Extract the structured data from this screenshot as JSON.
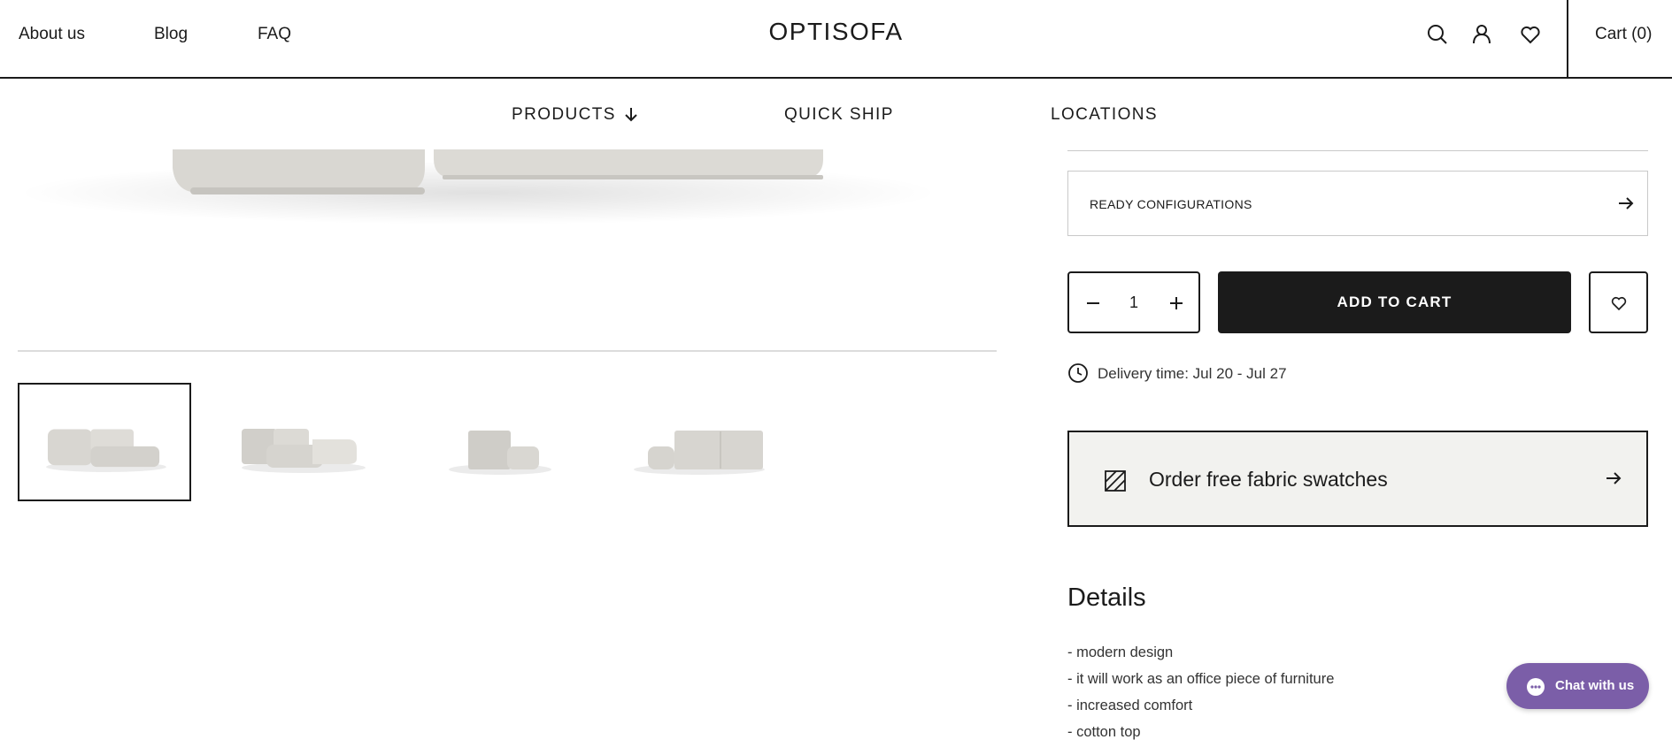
{
  "header": {
    "links": [
      "About us",
      "Blog",
      "FAQ"
    ],
    "logo": "OPTISOFA",
    "icons": [
      "search-icon",
      "user-icon",
      "heart-icon"
    ],
    "cart_label": "Cart (0)"
  },
  "nav": {
    "items": [
      "PRODUCTS",
      "QUICK SHIP",
      "LOCATIONS"
    ],
    "products_icon": "arrow-down-icon"
  },
  "gallery": {
    "thumbnail_count": 4,
    "active_index": 0
  },
  "product": {
    "ready_configurations_label": "READY CONFIGURATIONS",
    "quantity": "1",
    "add_to_cart_label": "ADD TO CART",
    "delivery_text": "Delivery time: Jul 20 - Jul 27",
    "swatches_label": "Order free fabric swatches"
  },
  "details": {
    "title": "Details",
    "items": [
      "- modern design",
      "- it will work as an office piece of furniture",
      "- increased comfort",
      "- cotton top"
    ]
  },
  "chat": {
    "label": "Chat with us"
  },
  "colors": {
    "text": "#1b1b1b",
    "button_dark": "#1b1b1b",
    "swatch_bg": "#f2f2ef",
    "chat_bg": "#7b5ea8",
    "sofa": "#d9d7d2"
  }
}
